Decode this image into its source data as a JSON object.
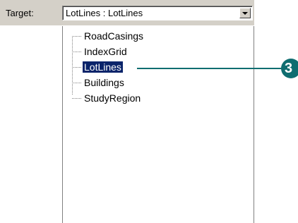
{
  "toolbar": {
    "target_label": "Target:",
    "combo_value": "LotLines : LotLines"
  },
  "tree": {
    "items": [
      {
        "label": "RoadCasings",
        "selected": false
      },
      {
        "label": "IndexGrid",
        "selected": false
      },
      {
        "label": "LotLines",
        "selected": true
      },
      {
        "label": "Buildings",
        "selected": false
      },
      {
        "label": "StudyRegion",
        "selected": false
      }
    ]
  },
  "callout": {
    "number": "3",
    "color": "#0f6d70"
  },
  "colors": {
    "selection": "#0a246a",
    "toolbar": "#d4d0c8"
  }
}
